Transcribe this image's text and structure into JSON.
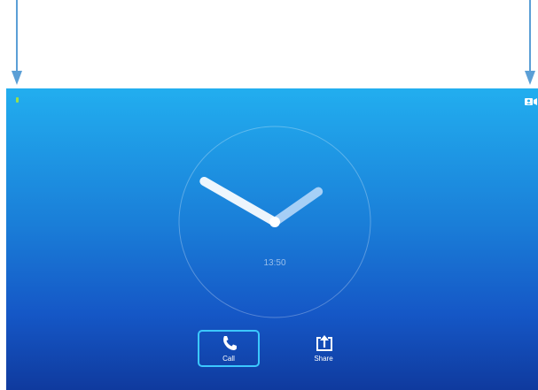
{
  "clock": {
    "time": "13:50",
    "hour": 13,
    "minute": 50
  },
  "status": {
    "indicator_color": "#9be04a",
    "icon": "camera-icon"
  },
  "actions": {
    "call": {
      "label": "Call",
      "icon": "phone-icon",
      "selected": true
    },
    "share": {
      "label": "Share",
      "icon": "share-icon",
      "selected": false
    }
  },
  "colors": {
    "arrow": "#5b9fd6",
    "selection_border": "#3cc8ff",
    "gradient_top": "#22aeef",
    "gradient_bottom": "#0f3a9e"
  }
}
